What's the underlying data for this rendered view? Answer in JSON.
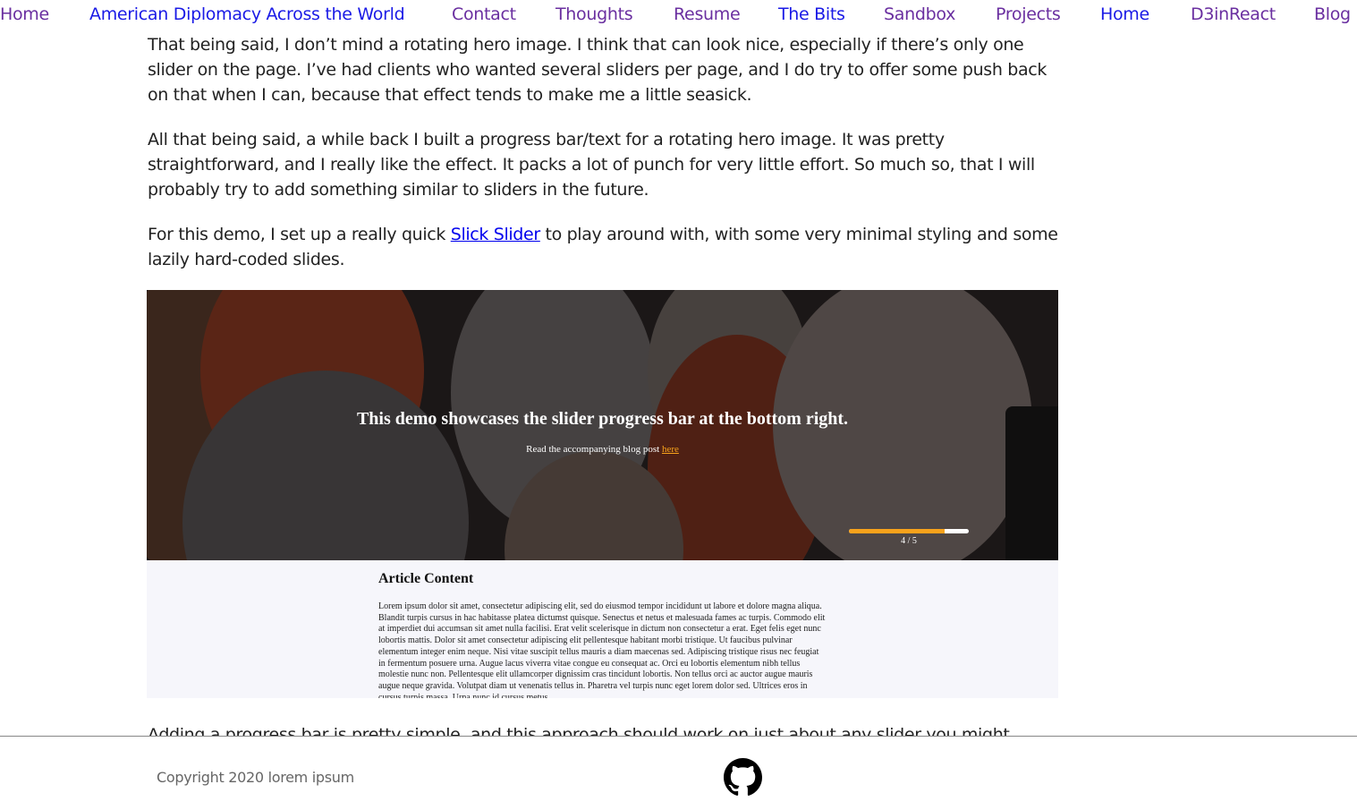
{
  "nav": {
    "links": [
      {
        "label": "Home",
        "state": "visited"
      },
      {
        "label": "American Diplomacy Across the World",
        "state": "unvisited"
      },
      {
        "label": "Contact",
        "state": "visited"
      },
      {
        "label": "Thoughts",
        "state": "visited"
      },
      {
        "label": "Resume",
        "state": "visited"
      },
      {
        "label": "The Bits",
        "state": "unvisited"
      },
      {
        "label": "Sandbox",
        "state": "visited"
      },
      {
        "label": "Projects",
        "state": "visited"
      },
      {
        "label": "Home",
        "state": "unvisited"
      },
      {
        "label": "D3inReact",
        "state": "visited"
      },
      {
        "label": "Blog",
        "state": "visited"
      }
    ]
  },
  "article": {
    "paragraphs": [
      "That being said, I don’t mind a rotating hero image. I think that can look nice, especially if there’s only one slider on the page. I’ve had clients who wanted several sliders per page, and I do try to offer some push back on that when I can, because that effect tends to make me a little seasick.",
      "All that being said, a while back I built a progress bar/text for a rotating hero image. It was pretty straightforward, and I really like the effect. It packs a lot of punch for very little effort. So much so, that I will probably try to add something similar to sliders in the future."
    ],
    "demo_para": {
      "before": "For this demo, I set up a really quick ",
      "link": "Slick Slider",
      "after": " to play around with, with some very minimal styling and some lazily hard-coded slides."
    },
    "next_para": "Adding a progress bar is pretty simple, and this approach should work on just about any slider you might"
  },
  "demo": {
    "hero_title": "This demo showcases the slider progress bar at the bottom right.",
    "hero_sub_before": "Read the accompanying blog post ",
    "hero_sub_link": "here",
    "progress": {
      "current": 4,
      "total": 5,
      "fill_fraction": 0.8,
      "label": "4 / 5"
    },
    "accent_color": "#f7a21b",
    "article_heading": "Article Content",
    "article_body": "Lorem ipsum dolor sit amet, consectetur adipiscing elit, sed do eiusmod tempor incididunt ut labore et dolore magna aliqua. Blandit turpis cursus in hac habitasse platea dictumst quisque. Senectus et netus et malesuada fames ac turpis. Commodo elit at imperdiet dui accumsan sit amet nulla facilisi. Erat velit scelerisque in dictum non consectetur a erat. Eget felis eget nunc lobortis mattis. Dolor sit amet consectetur adipiscing elit pellentesque habitant morbi tristique. Ut faucibus pulvinar elementum integer enim neque. Nisi vitae suscipit tellus mauris a diam maecenas sed. Adipiscing tristique risus nec feugiat in fermentum posuere urna. Augue lacus viverra vitae congue eu consequat ac. Orci eu lobortis elementum nibh tellus molestie nunc non. Pellentesque elit ullamcorper dignissim cras tincidunt lobortis. Non tellus orci ac auctor augue mauris augue neque gravida. Volutpat diam ut venenatis tellus in. Pharetra vel turpis nunc eget lorem dolor sed. Ultrices eros in cursus turpis massa. Urna nunc id cursus metus."
  },
  "footer": {
    "copyright": "Copyright 2020 lorem ipsum",
    "icon": "github-icon"
  }
}
